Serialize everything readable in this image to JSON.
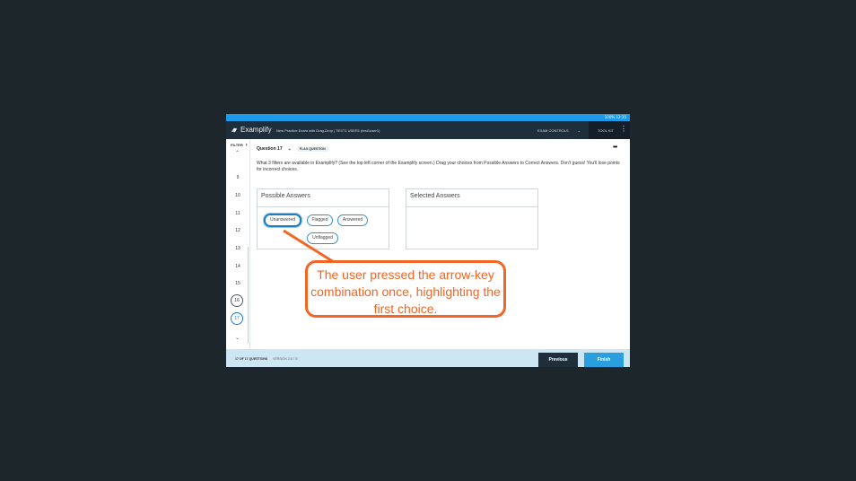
{
  "status_bar": {
    "text": "100% 12:35"
  },
  "app_bar": {
    "app_name": "Examplify",
    "exam_title": "New Practice Exam with Drag-Drop | TEST1 USER1 (test1user1)",
    "exam_controls_label": "EXAM CONTROLS",
    "tool_kit_label": "TOOL KIT"
  },
  "left_nav": {
    "filter_label": "FILTER",
    "questions": [
      "9",
      "10",
      "11",
      "12",
      "13",
      "14",
      "15",
      "16",
      "17"
    ],
    "current": "17"
  },
  "question": {
    "header": "Question 17",
    "flag_label": "FLAG QUESTION",
    "text": "What 3 filters are available in Examplify? (See the top left corner of the Examplify screen.) Drag your choices from Possible Answers to Correct Answers. Don't guess! You'll lose points for incorrect choices."
  },
  "possible_answers": {
    "title": "Possible Answers",
    "choices": [
      "Unanswered",
      "Flagged",
      "Answered",
      "Unflagged"
    ],
    "highlighted": "Unanswered"
  },
  "selected_answers": {
    "title": "Selected Answers"
  },
  "footer": {
    "count": "17 OF 17 QUESTIONS",
    "version": "VERSION 2.8.7.5",
    "previous_label": "Previous",
    "finish_label": "Finish"
  },
  "callout": {
    "text": "The user pressed the arrow-key combination once, highlighting the first choice."
  },
  "colors": {
    "accent": "#1e9be8",
    "header": "#1f2e3b",
    "callout": "#f26522"
  }
}
